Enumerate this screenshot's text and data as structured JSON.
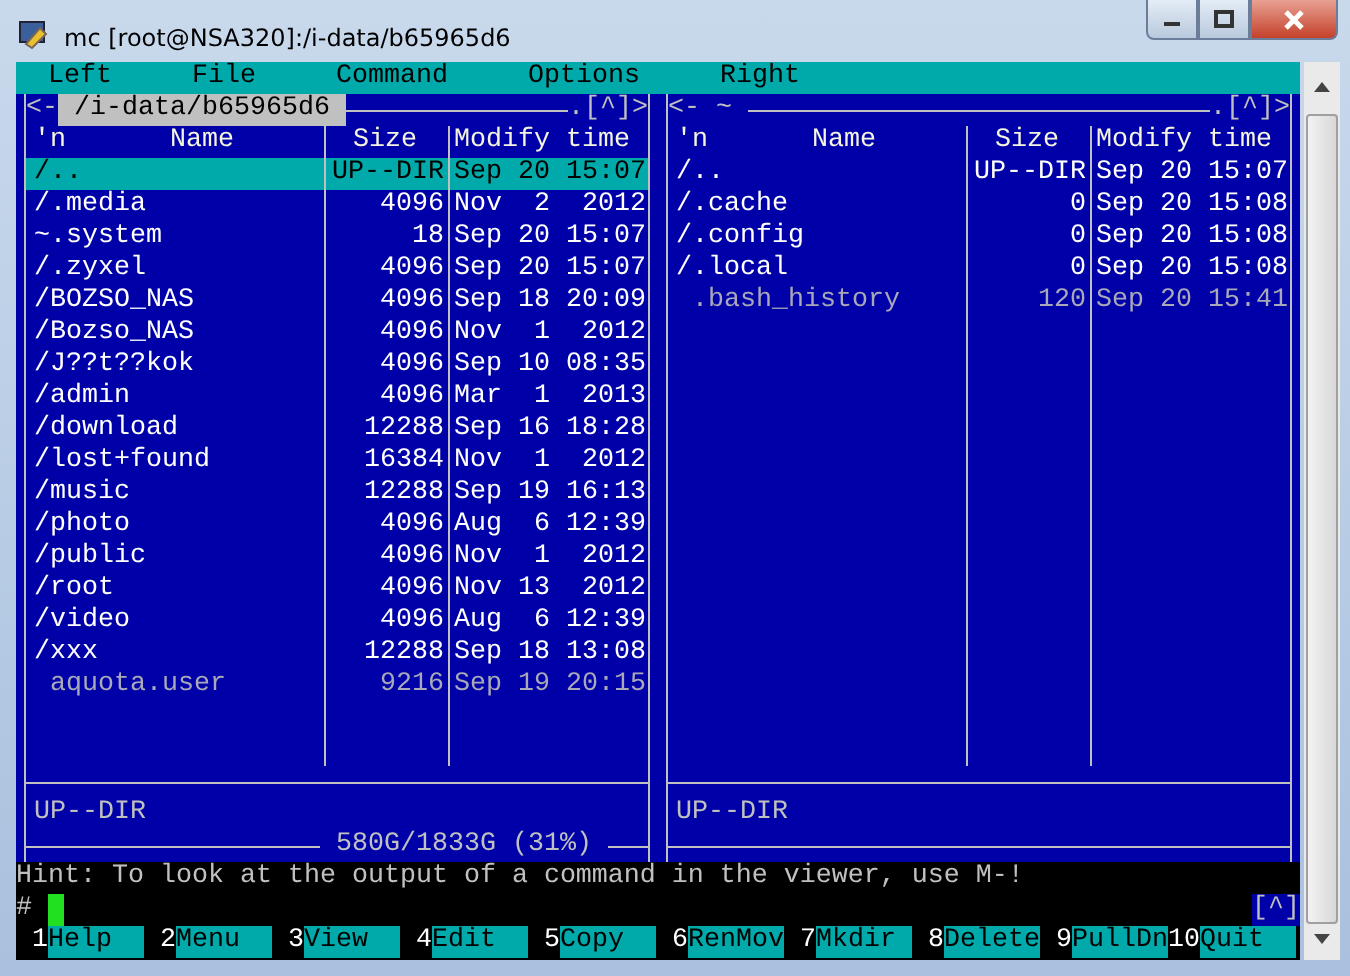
{
  "window": {
    "title": "mc [root@NSA320]:/i-data/b65965d6"
  },
  "menu": [
    "Left",
    "File",
    "Command",
    "Options",
    "Right"
  ],
  "panels": [
    {
      "corner_left": "<-",
      "path": "/i-data/b65965d6",
      "active": true,
      "corner_right": ".[^]>",
      "columns": {
        "sort_mark": "'n",
        "name": "Name",
        "size": "Size",
        "time": "Modify time"
      },
      "rows": [
        {
          "name": "/..",
          "size": "UP--DIR",
          "time": "Sep 20 15:07",
          "kind": "dir",
          "selected": true
        },
        {
          "name": "/.media",
          "size": "4096",
          "time": "Nov  2  2012",
          "kind": "dir",
          "selected": false
        },
        {
          "name": "~.system",
          "size": "18",
          "time": "Sep 20 15:07",
          "kind": "dir",
          "selected": false
        },
        {
          "name": "/.zyxel",
          "size": "4096",
          "time": "Sep 20 15:07",
          "kind": "dir",
          "selected": false
        },
        {
          "name": "/BOZSO_NAS",
          "size": "4096",
          "time": "Sep 18 20:09",
          "kind": "dir",
          "selected": false
        },
        {
          "name": "/Bozso_NAS",
          "size": "4096",
          "time": "Nov  1  2012",
          "kind": "dir",
          "selected": false
        },
        {
          "name": "/J??t??kok",
          "size": "4096",
          "time": "Sep 10 08:35",
          "kind": "dir",
          "selected": false
        },
        {
          "name": "/admin",
          "size": "4096",
          "time": "Mar  1  2013",
          "kind": "dir",
          "selected": false
        },
        {
          "name": "/download",
          "size": "12288",
          "time": "Sep 16 18:28",
          "kind": "dir",
          "selected": false
        },
        {
          "name": "/lost+found",
          "size": "16384",
          "time": "Nov  1  2012",
          "kind": "dir",
          "selected": false
        },
        {
          "name": "/music",
          "size": "12288",
          "time": "Sep 19 16:13",
          "kind": "dir",
          "selected": false
        },
        {
          "name": "/photo",
          "size": "4096",
          "time": "Aug  6 12:39",
          "kind": "dir",
          "selected": false
        },
        {
          "name": "/public",
          "size": "4096",
          "time": "Nov  1  2012",
          "kind": "dir",
          "selected": false
        },
        {
          "name": "/root",
          "size": "4096",
          "time": "Nov 13  2012",
          "kind": "dir",
          "selected": false
        },
        {
          "name": "/video",
          "size": "4096",
          "time": "Aug  6 12:39",
          "kind": "dir",
          "selected": false
        },
        {
          "name": "/xxx",
          "size": "12288",
          "time": "Sep 18 13:08",
          "kind": "dir",
          "selected": false
        },
        {
          "name": " aquota.user",
          "size": "9216",
          "time": "Sep 19 20:15",
          "kind": "file",
          "selected": false
        }
      ],
      "status": "UP--DIR",
      "disk_info": "580G/1833G (31%)"
    },
    {
      "corner_left": "<-",
      "path": "~",
      "active": false,
      "corner_right": ".[^]>",
      "columns": {
        "sort_mark": "'n",
        "name": "Name",
        "size": "Size",
        "time": "Modify time"
      },
      "rows": [
        {
          "name": "/..",
          "size": "UP--DIR",
          "time": "Sep 20 15:07",
          "kind": "dir",
          "selected": false
        },
        {
          "name": "/.cache",
          "size": "0",
          "time": "Sep 20 15:08",
          "kind": "dir",
          "selected": false
        },
        {
          "name": "/.config",
          "size": "0",
          "time": "Sep 20 15:08",
          "kind": "dir",
          "selected": false
        },
        {
          "name": "/.local",
          "size": "0",
          "time": "Sep 20 15:08",
          "kind": "dir",
          "selected": false
        },
        {
          "name": " .bash_history",
          "size": "120",
          "time": "Sep 20 15:41",
          "kind": "file",
          "selected": false
        }
      ],
      "status": "UP--DIR"
    }
  ],
  "hint": "Hint: To look at the output of a command in the viewer, use M-!",
  "prompt": "#",
  "scroll_marker": "[^]",
  "function_keys": [
    {
      "number": "1",
      "label": "Help"
    },
    {
      "number": "2",
      "label": "Menu"
    },
    {
      "number": "3",
      "label": "View"
    },
    {
      "number": "4",
      "label": "Edit"
    },
    {
      "number": "5",
      "label": "Copy"
    },
    {
      "number": "6",
      "label": "RenMov"
    },
    {
      "number": "7",
      "label": "Mkdir"
    },
    {
      "number": "8",
      "label": "Delete"
    },
    {
      "number": "9",
      "label": "PullDn"
    },
    {
      "number": "10",
      "label": "Quit"
    }
  ]
}
